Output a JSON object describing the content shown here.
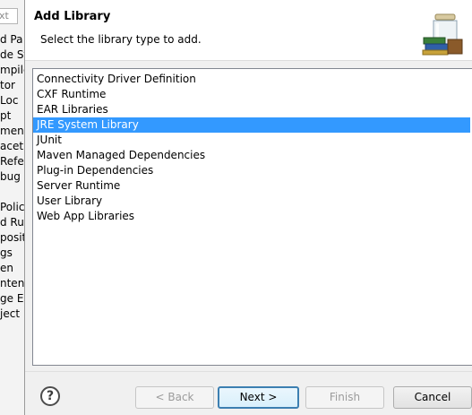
{
  "background_window": {
    "filter_placeholder": "xt",
    "items": [
      "d Pa",
      "de St",
      "mpile",
      "tor",
      "Loc",
      "pt",
      "ment",
      "acet",
      "Refe",
      "bug S",
      "",
      "Polic",
      "d Ru",
      "posit",
      "gs",
      "en",
      "ntent",
      "ge E",
      "ject"
    ]
  },
  "dialog": {
    "title": "Add Library",
    "subtitle": "Select the library type to add.",
    "icon": "library-jar-icon"
  },
  "library_types": [
    {
      "label": "Connectivity Driver Definition",
      "selected": false
    },
    {
      "label": "CXF Runtime",
      "selected": false
    },
    {
      "label": "EAR Libraries",
      "selected": false
    },
    {
      "label": "JRE System Library",
      "selected": true
    },
    {
      "label": "JUnit",
      "selected": false
    },
    {
      "label": "Maven Managed Dependencies",
      "selected": false
    },
    {
      "label": "Plug-in Dependencies",
      "selected": false
    },
    {
      "label": "Server Runtime",
      "selected": false
    },
    {
      "label": "User Library",
      "selected": false
    },
    {
      "label": "Web App Libraries",
      "selected": false
    }
  ],
  "buttons": {
    "help": "?",
    "back": "< Back",
    "next": "Next >",
    "finish": "Finish",
    "cancel": "Cancel"
  },
  "colors": {
    "selection": "#3399ff"
  }
}
